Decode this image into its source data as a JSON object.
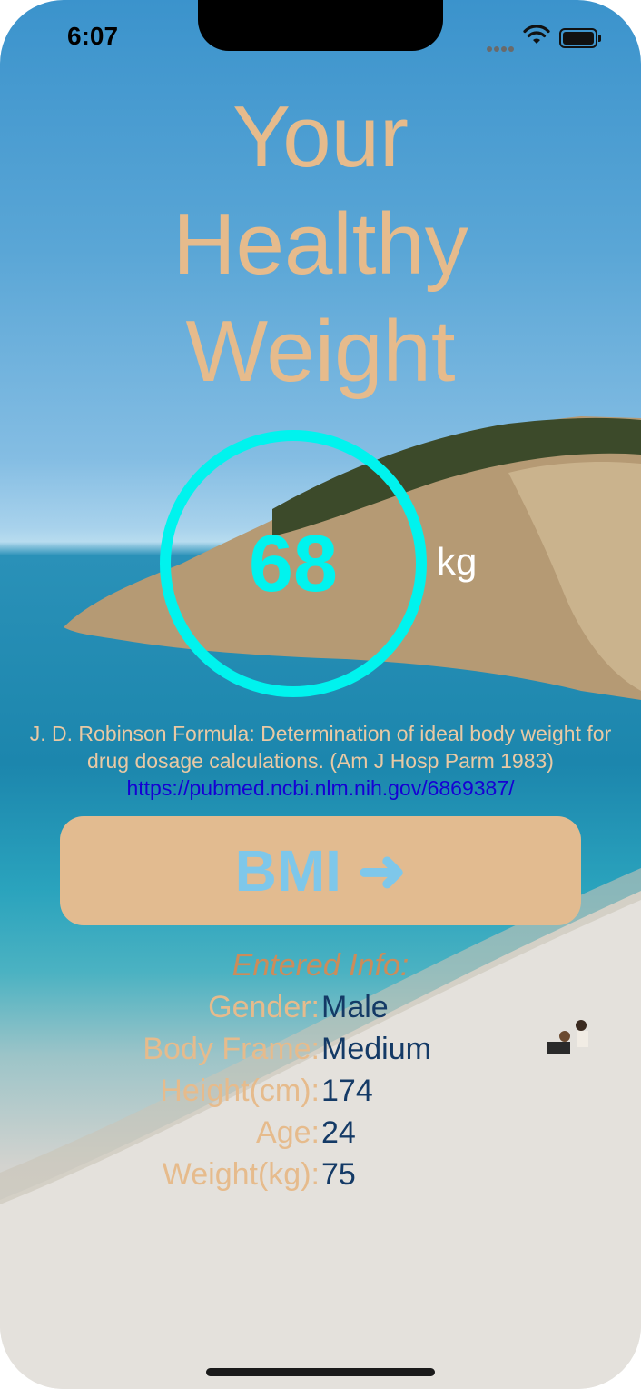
{
  "status_bar": {
    "time": "6:07"
  },
  "title": {
    "line1": "Your",
    "line2": "Healthy",
    "line3": "Weight"
  },
  "result": {
    "value": "68",
    "unit": "kg",
    "ring_color": "#00f3ee"
  },
  "citation": {
    "line1": "J. D. Robinson Formula: Determination of ideal body weight for",
    "line2": "drug dosage calculations. (Am J Hosp Parm 1983)",
    "link": "https://pubmed.ncbi.nlm.nih.gov/6869387/"
  },
  "bmi_button": {
    "label": "BMI ➜"
  },
  "entered_info": {
    "heading": "Entered Info:",
    "rows": [
      {
        "label": "Gender:",
        "value": "Male"
      },
      {
        "label": "Body Frame:",
        "value": "Medium"
      },
      {
        "label": "Height(cm):",
        "value": "174"
      },
      {
        "label": "Age:",
        "value": "24"
      },
      {
        "label": "Weight(kg):",
        "value": "75"
      }
    ]
  },
  "colors": {
    "accent": "#e6bb8c",
    "value_text": "#143a66",
    "link": "#1500d4"
  }
}
